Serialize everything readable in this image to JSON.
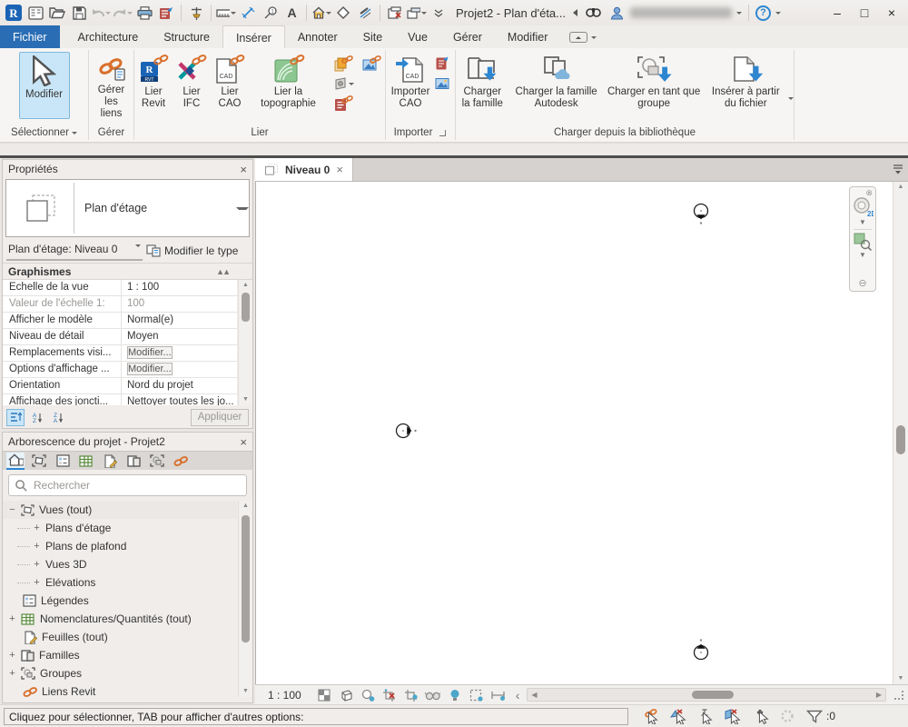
{
  "titlebar": {
    "project_title": "Projet2 - Plan d'éta...",
    "help": "?"
  },
  "ribbon_tabs": {
    "file": "Fichier",
    "architecture": "Architecture",
    "structure": "Structure",
    "inserer": "Insérer",
    "annoter": "Annoter",
    "site": "Site",
    "vue": "Vue",
    "gerer": "Gérer",
    "modifier": "Modifier"
  },
  "ribbon": {
    "select": {
      "button": "Modifier",
      "panel": "Sélectionner"
    },
    "manage": {
      "button": "Gérer les liens",
      "panel": "Gérer"
    },
    "link": {
      "revit": "Lier Revit",
      "ifc": "Lier IFC",
      "cad": "Lier CAO",
      "topo": "Lier la topographie",
      "panel": "Lier"
    },
    "import": {
      "cad": "Importer CAO",
      "panel": "Importer"
    },
    "load": {
      "family": "Charger la famille",
      "autodesk": "Charger la famille Autodesk",
      "group": "Charger en tant que groupe",
      "file": "Insérer à partir du fichier",
      "panel": "Charger depuis la bibliothèque"
    }
  },
  "properties": {
    "title": "Propriétés",
    "type_name": "Plan d'étage",
    "instance": "Plan d'étage: Niveau 0",
    "edit_type": "Modifier le type",
    "section": "Graphismes",
    "rows": [
      {
        "label": "Echelle de la vue",
        "value": "1 : 100"
      },
      {
        "label": "Valeur de l'échelle  1:",
        "value": "100"
      },
      {
        "label": "Afficher le modèle",
        "value": "Normal(e)"
      },
      {
        "label": "Niveau de détail",
        "value": "Moyen"
      },
      {
        "label": "Remplacements visi...",
        "value": "Modifier..."
      },
      {
        "label": "Options d'affichage ...",
        "value": "Modifier..."
      },
      {
        "label": "Orientation",
        "value": "Nord du projet"
      },
      {
        "label": "Affichage des joncti...",
        "value": "Nettoyer toutes les jo..."
      }
    ],
    "apply": "Appliquer"
  },
  "browser": {
    "title": "Arborescence du projet - Projet2",
    "search_placeholder": "Rechercher",
    "tree": [
      {
        "label": "Vues (tout)"
      },
      {
        "label": "Plans d'étage"
      },
      {
        "label": "Plans de plafond"
      },
      {
        "label": "Vues 3D"
      },
      {
        "label": "Elévations"
      },
      {
        "label": "Légendes"
      },
      {
        "label": "Nomenclatures/Quantités (tout)"
      },
      {
        "label": "Feuilles (tout)"
      },
      {
        "label": "Familles"
      },
      {
        "label": "Groupes"
      },
      {
        "label": "Liens Revit"
      }
    ]
  },
  "viewport": {
    "tab": "Niveau 0",
    "scale": "1 : 100"
  },
  "statusbar": {
    "message": "Cliquez pour sélectionner, TAB pour afficher d'autres options:",
    "filter_count": ":0"
  }
}
